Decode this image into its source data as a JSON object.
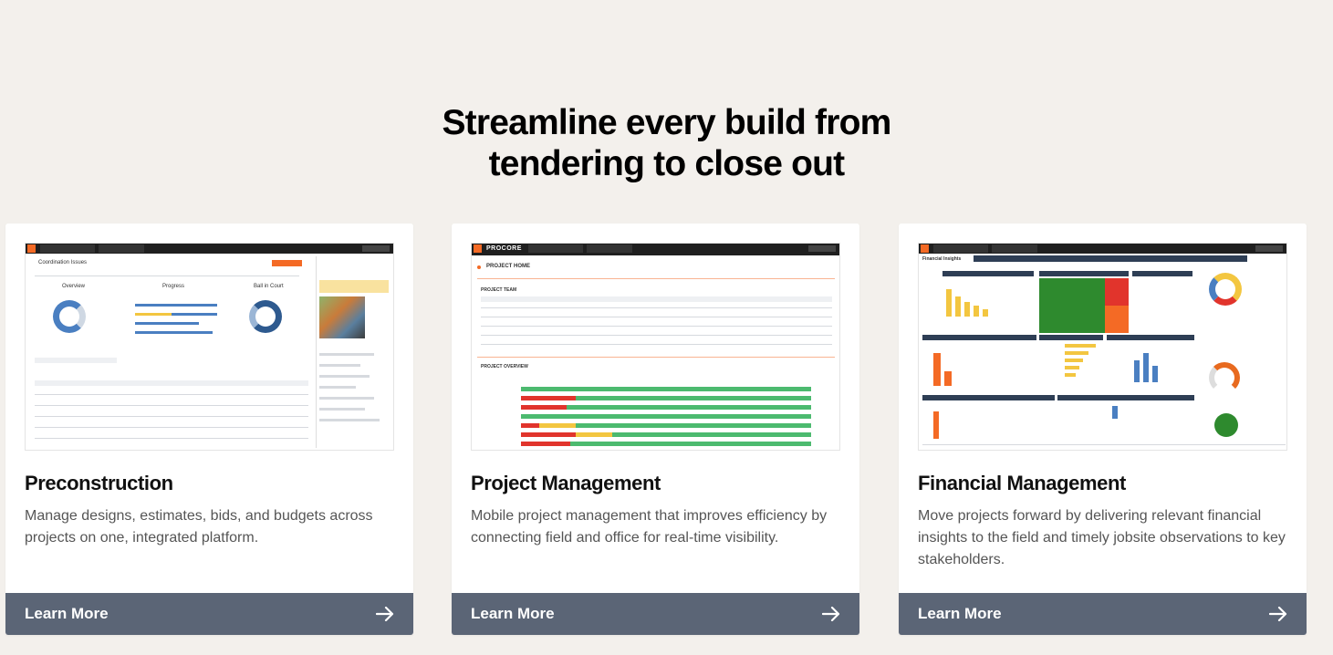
{
  "headline": {
    "line1": "Streamline every build from",
    "line2": "tendering to close out"
  },
  "cards": [
    {
      "title": "Preconstruction",
      "description": "Manage designs, estimates, bids, and budgets across projects on one, integrated platform.",
      "button_label": "Learn More",
      "screenshot": {
        "header": "Coordination Issues",
        "chart_labels": [
          "Overview",
          "Progress",
          "Ball in Court"
        ]
      }
    },
    {
      "title": "Project Management",
      "description": "Mobile project management that improves efficiency by connecting field and office for real-time visibility.",
      "button_label": "Learn More",
      "screenshot": {
        "brand": "PROCORE",
        "header": "PROJECT HOME",
        "team_label": "PROJECT TEAM",
        "overview_label": "PROJECT OVERVIEW"
      }
    },
    {
      "title": "Financial Management",
      "description": "Move projects forward by delivering relevant financial insights to the field and timely jobsite observations to key stakeholders.",
      "button_label": "Learn More",
      "screenshot": {
        "header": "Financial Insights"
      }
    }
  ],
  "colors": {
    "background": "#f3f0ec",
    "button": "#5b6576",
    "accent": "#f46a25"
  },
  "icons": {
    "button_arrow": "arrow-right-icon"
  }
}
